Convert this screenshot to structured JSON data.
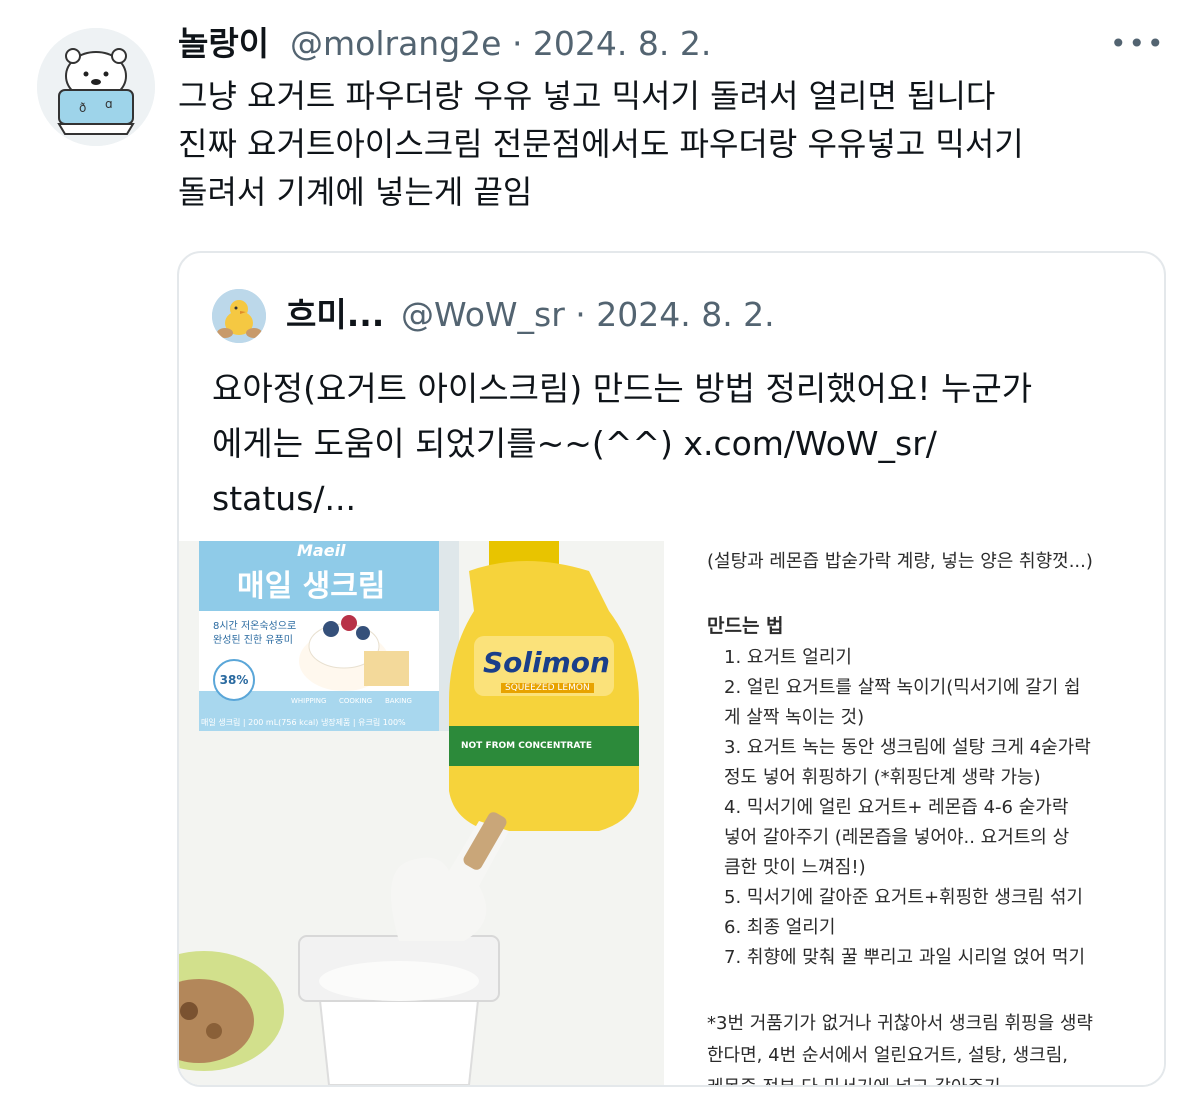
{
  "tweet": {
    "name": "놀랑이",
    "handle_date": "@molrang2e · 2024. 8. 2.",
    "more_icon": "more-horizontal-icon",
    "text_lines": [
      "그냥 요거트 파우더랑 우유 넣고 믹서기 돌려서 얼리면 됩니다",
      "진짜 요거트아이스크림 전문점에서도 파우더랑 우유넣고 믹서기",
      "돌려서 기계에 넣는게 끝임"
    ]
  },
  "quote": {
    "name": "흐미...",
    "handle_date": "@WoW_sr · 2024. 8. 2.",
    "text_lines": [
      "요아정(요거트 아이스크림) 만드는 방법 정리했어요! 누군가",
      "에게는 도움이 되었기를~~(^^) x.com/WoW_sr/",
      "status/..."
    ],
    "photo": {
      "cream_brand": "Maeil",
      "cream_name": "매일 생크림",
      "cream_sub1": "8시간 저온숙성으로",
      "cream_sub2": "완성된 진한 유풍미",
      "cream_badge": "38%",
      "cream_tags": [
        "WHIPPING",
        "COOKING",
        "BAKING"
      ],
      "cream_footer": "매일 생크림 | 200 mL(756 kcal) 냉장제품 | 유크림 100%",
      "lemon_brand": "Solimon",
      "lemon_sub": "SQUEEZED LEMON",
      "lemon_band": "NOT FROM CONCENTRATE"
    },
    "document": {
      "note": "(설탕과 레몬즙 밥숟가락 계량, 넣는 양은 취향껏...)",
      "heading": "만드는 법",
      "steps": [
        "1.  요거트 얼리기",
        "2.  얼린 요거트를 살짝 녹이기(믹서기에 갈기 쉽",
        "     게 살짝 녹이는 것)",
        "3.  요거트 녹는 동안 생크림에 설탕 크게 4숟가락",
        "     정도 넣어 휘핑하기 (*휘핑단계 생략 가능)",
        "4.  믹서기에 얼린 요거트+ 레몬즙 4-6 숟가락",
        "     넣어 갈아주기 (레몬즙을 넣어야.. 요거트의 상",
        "     큼한 맛이 느껴짐!)",
        "5.  믹서기에 갈아준 요거트+휘핑한 생크림 섞기",
        "6.  최종 얼리기",
        "7.  취향에 맞춰 꿀 뿌리고 과일 시리얼 얹어 먹기"
      ],
      "footnote": [
        "*3번 거품기가 없거나 귀찮아서 생크림 휘핑을 생략",
        "한다면,  4번 순서에서 얼린요거트, 설탕, 생크림,",
        "레몬즙 전부 다 믹서기에 넣고 갈아주기"
      ]
    }
  }
}
